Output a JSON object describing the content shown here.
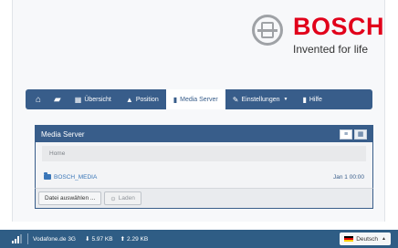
{
  "brand": {
    "name": "BOSCH",
    "tagline": "Invented for life",
    "color": "#e1001a"
  },
  "nav": {
    "items": [
      {
        "name": "home",
        "label": "",
        "icon": "home-icon"
      },
      {
        "name": "chat",
        "label": "",
        "icon": "chat-icon"
      },
      {
        "name": "overview",
        "label": "Übersicht",
        "icon": "grid-icon"
      },
      {
        "name": "position",
        "label": "Position",
        "icon": "position-icon"
      },
      {
        "name": "media-server",
        "label": "Media Server",
        "icon": "file-icon",
        "active": true
      },
      {
        "name": "settings",
        "label": "Einstellungen",
        "icon": "wrench-icon"
      },
      {
        "name": "help",
        "label": "Hilfe",
        "icon": "book-icon"
      }
    ]
  },
  "panel": {
    "title": "Media Server",
    "breadcrumb": "Home",
    "files": [
      {
        "name": "BOSCH_MEDIA",
        "date": "Jan 1 00:00",
        "icon": "folder-icon"
      }
    ],
    "actions": {
      "choose_file": "Datei auswählen ...",
      "upload": "Laden"
    }
  },
  "statusbar": {
    "network": "Vodafone.de 3G",
    "download": "5.97 KB",
    "upload": "2.29 KB",
    "language": "Deutsch"
  },
  "colors": {
    "nav_bg": "#385d8a",
    "statusbar_bg": "#2f5d85",
    "link": "#3a76b8"
  }
}
